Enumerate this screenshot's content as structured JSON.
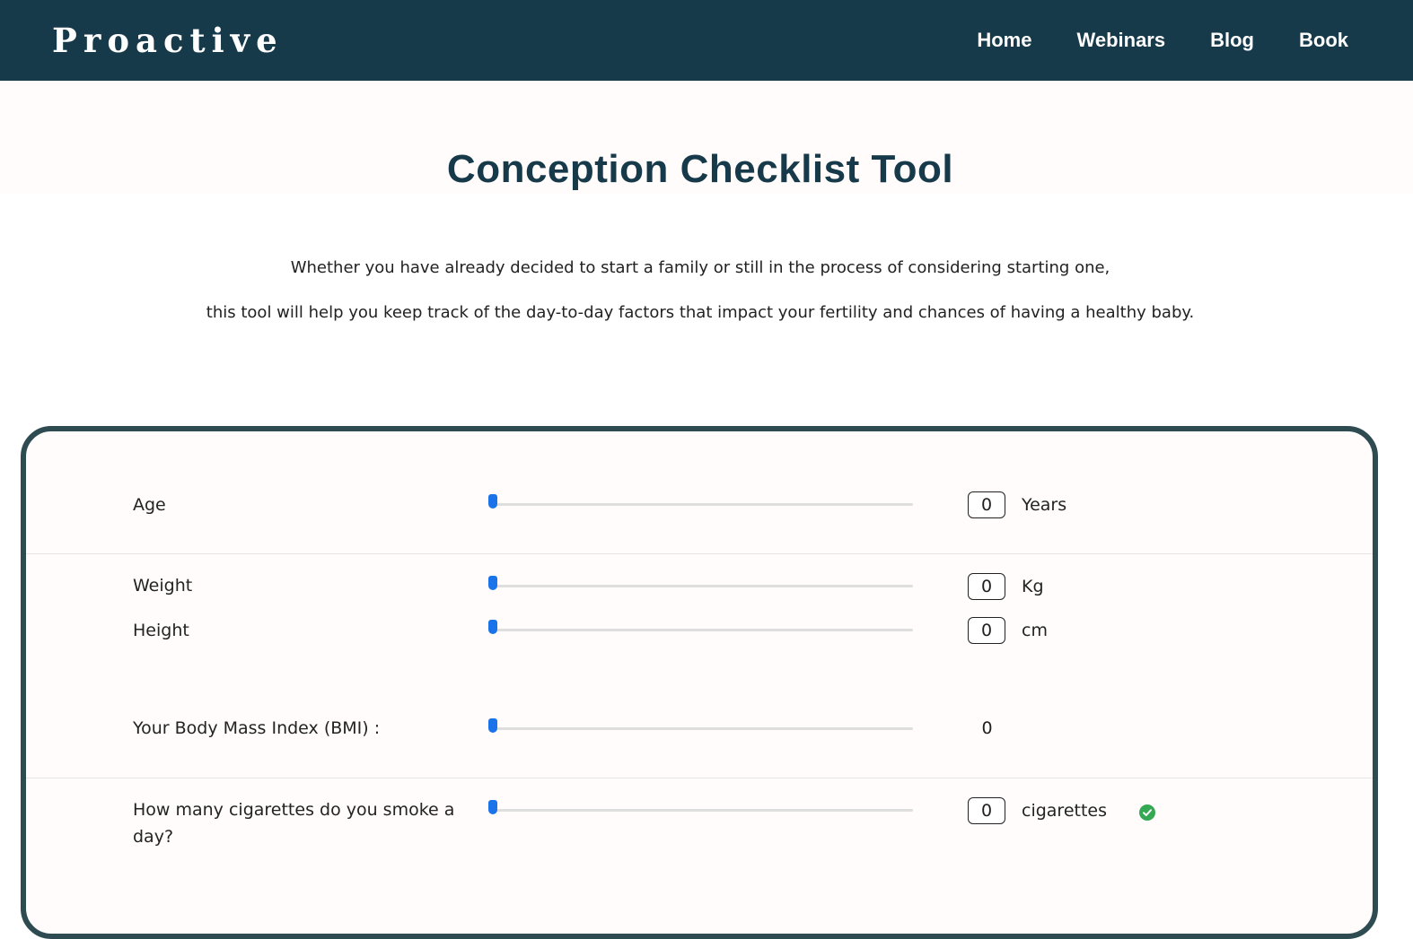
{
  "header": {
    "brand": "Proactive",
    "nav": [
      "Home",
      "Webinars",
      "Blog",
      "Book"
    ]
  },
  "page": {
    "title": "Conception Checklist Tool",
    "intro_line1": "Whether you have already decided to start a family or still in the process of considering starting one,",
    "intro_line2": "this tool will help you keep track of the day-to-day factors that impact your fertility and chances of having a healthy baby."
  },
  "form": {
    "age": {
      "label": "Age",
      "value": "0",
      "unit": "Years",
      "slider_fraction": 0
    },
    "weight": {
      "label": "Weight",
      "value": "0",
      "unit": "Kg",
      "slider_fraction": 0
    },
    "height": {
      "label": "Height",
      "value": "0",
      "unit": "cm",
      "slider_fraction": 0
    },
    "bmi": {
      "label": "Your Body Mass Index (BMI) :",
      "value": "0",
      "slider_fraction": 0
    },
    "cigarettes": {
      "label": "How many cigarettes do you smoke a day?",
      "value": "0",
      "unit": "cigarettes",
      "slider_fraction": 0,
      "status_icon": "check-circle-icon"
    }
  },
  "colors": {
    "header_bg": "#173a4b",
    "title": "#173a4b",
    "card_border": "#2f4b52",
    "slider_thumb": "#1a73e8",
    "ok_green": "#34a853"
  }
}
